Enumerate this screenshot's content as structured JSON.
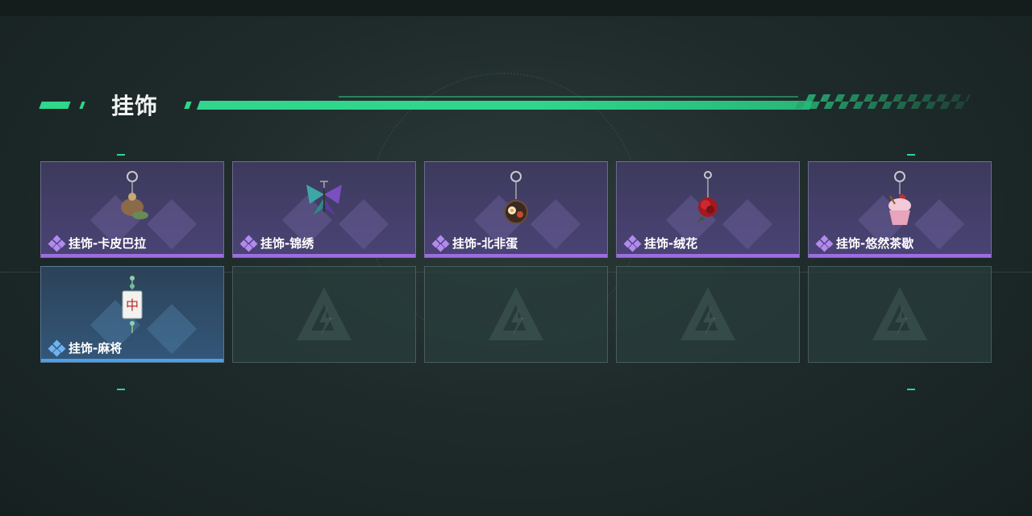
{
  "section": {
    "title": "挂饰"
  },
  "items": [
    {
      "label": "挂饰-卡皮巴拉",
      "icon": "capybara-charm-icon",
      "rarity": "purple"
    },
    {
      "label": "挂饰-锦绣",
      "icon": "butterfly-charm-icon",
      "rarity": "purple"
    },
    {
      "label": "挂饰-北非蛋",
      "icon": "shakshuka-charm-icon",
      "rarity": "purple"
    },
    {
      "label": "挂饰-绒花",
      "icon": "rose-charm-icon",
      "rarity": "purple"
    },
    {
      "label": "挂饰-悠然茶歇",
      "icon": "cupcake-charm-icon",
      "rarity": "purple"
    },
    {
      "label": "挂饰-麻将",
      "icon": "mahjong-charm-icon",
      "rarity": "blue"
    }
  ],
  "empty_slots": 4,
  "colors": {
    "accent": "#2fd68c",
    "purple_rarity": "#9b6fe0",
    "blue_rarity": "#4d9fe6"
  }
}
